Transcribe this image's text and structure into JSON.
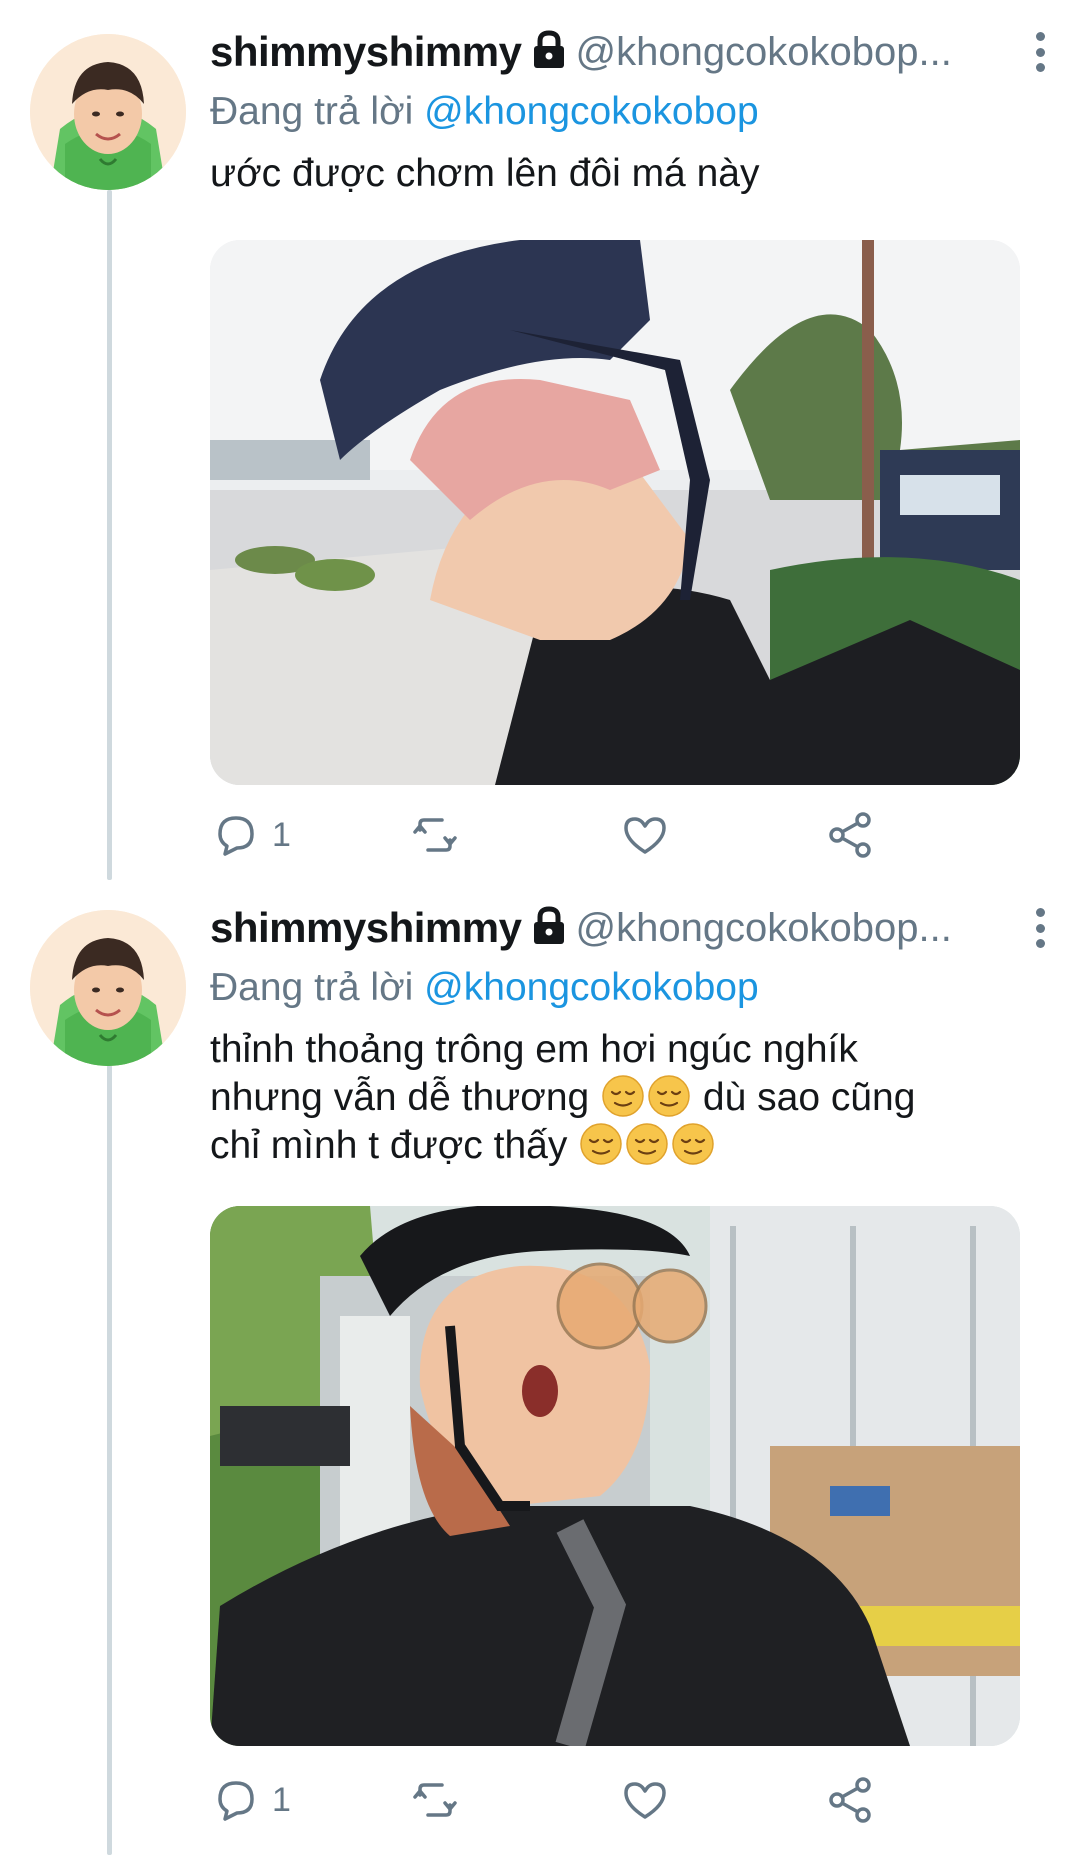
{
  "tweets": [
    {
      "display_name": "shimmyshimmy",
      "handle": "@khongcokokobop...",
      "replying_prefix": "Đang trả lời",
      "replying_to": "@khongcokokobop",
      "text": "ước được chơm lên đôi má này",
      "reply_count": "1",
      "retweet_count": "",
      "like_count": ""
    },
    {
      "display_name": "shimmyshimmy",
      "handle": "@khongcokokobop...",
      "replying_prefix": "Đang trả lời",
      "replying_to": "@khongcokokobop",
      "text_line1": "thỉnh thoảng trông em hơi ngúc nghík",
      "text_line2_before": "nhưng vẫn dễ thương",
      "text_line2_after": "dù sao cũng",
      "text_line3": "chỉ mình t được thấy",
      "reply_count": "1",
      "retweet_count": "",
      "like_count": ""
    }
  ],
  "icons": {
    "reply": "reply-icon",
    "retweet": "retweet-icon",
    "like": "heart-icon",
    "share": "share-icon",
    "lock": "lock-icon",
    "more": "more-vertical-icon",
    "emoji": "relieved-face-emoji"
  },
  "colors": {
    "mention": "#1b95e0",
    "secondary_text": "#657786",
    "thread_line": "#cfd9de"
  }
}
